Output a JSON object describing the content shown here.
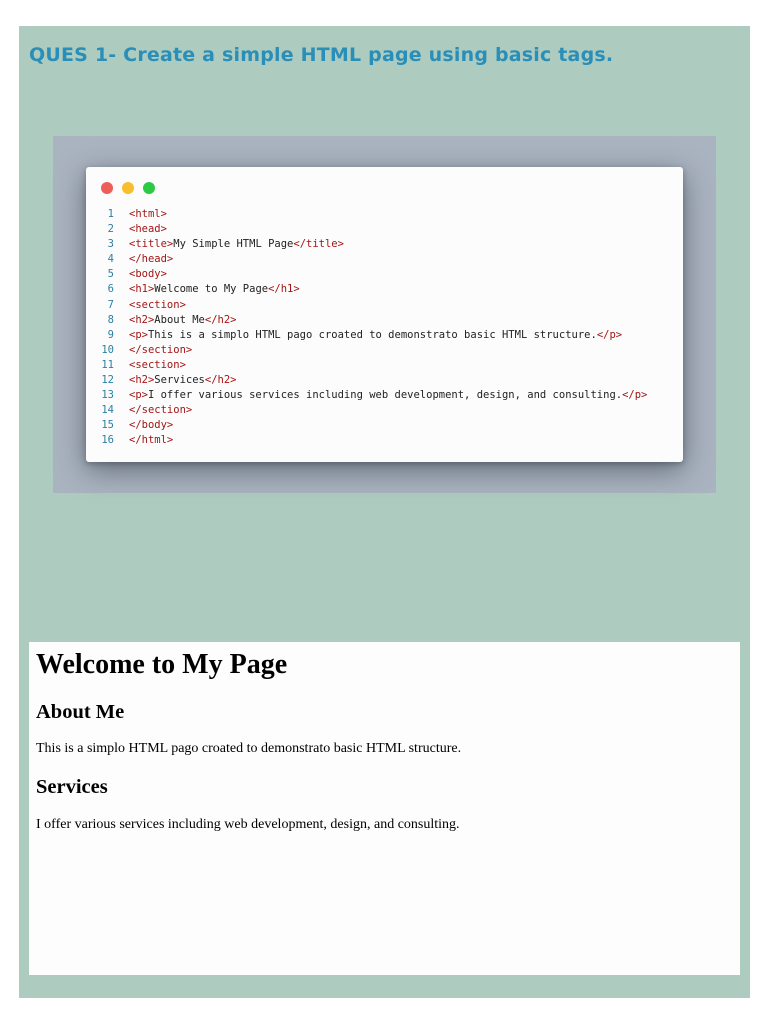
{
  "question": {
    "title": "QUES 1- Create a simple HTML page using basic tags."
  },
  "code": {
    "lines": [
      {
        "n": "1",
        "parts": [
          [
            "t",
            "<html>"
          ]
        ]
      },
      {
        "n": "2",
        "parts": [
          [
            "t",
            "<head>"
          ]
        ]
      },
      {
        "n": "3",
        "parts": [
          [
            "t",
            "<title>"
          ],
          [
            "x",
            "My Simple HTML Page"
          ],
          [
            "t",
            "</title>"
          ]
        ]
      },
      {
        "n": "4",
        "parts": [
          [
            "t",
            "</head>"
          ]
        ]
      },
      {
        "n": "5",
        "parts": [
          [
            "t",
            "<body>"
          ]
        ]
      },
      {
        "n": "6",
        "parts": [
          [
            "t",
            "<h1>"
          ],
          [
            "x",
            "Welcome to My Page"
          ],
          [
            "t",
            "</h1>"
          ]
        ]
      },
      {
        "n": "7",
        "parts": [
          [
            "t",
            "<section>"
          ]
        ]
      },
      {
        "n": "8",
        "parts": [
          [
            "t",
            "<h2>"
          ],
          [
            "x",
            "About Me"
          ],
          [
            "t",
            "</h2>"
          ]
        ]
      },
      {
        "n": "9",
        "parts": [
          [
            "t",
            "<p>"
          ],
          [
            "x",
            "This is a simplo HTML pago croated to demonstrato basic HTML structure."
          ],
          [
            "t",
            "</p>"
          ]
        ]
      },
      {
        "n": "10",
        "parts": [
          [
            "t",
            "</section>"
          ]
        ]
      },
      {
        "n": "11",
        "parts": [
          [
            "t",
            "<section>"
          ]
        ]
      },
      {
        "n": "12",
        "parts": [
          [
            "t",
            "<h2>"
          ],
          [
            "x",
            "Services"
          ],
          [
            "t",
            "</h2>"
          ]
        ]
      },
      {
        "n": "13",
        "parts": [
          [
            "t",
            "<p>"
          ],
          [
            "x",
            "I offer various services including web development, design, and consulting."
          ],
          [
            "t",
            "</p>"
          ]
        ]
      },
      {
        "n": "14",
        "parts": [
          [
            "t",
            "</section>"
          ]
        ]
      },
      {
        "n": "15",
        "parts": [
          [
            "t",
            "</body>"
          ]
        ]
      },
      {
        "n": "16",
        "parts": [
          [
            "t",
            "</html>"
          ]
        ]
      }
    ]
  },
  "preview": {
    "h1": "Welcome to My Page",
    "h2_about": "About Me",
    "p_about": "This is a simplo HTML pago croated to demonstrato basic HTML structure.",
    "h2_services": "Services",
    "p_services": "I offer various services including web development, design, and consulting."
  },
  "colors": {
    "sheet_bg": "#aecbbf",
    "question_text": "#2a8fb8",
    "tag": "#a31515",
    "line_number": "#2b7fa5"
  }
}
